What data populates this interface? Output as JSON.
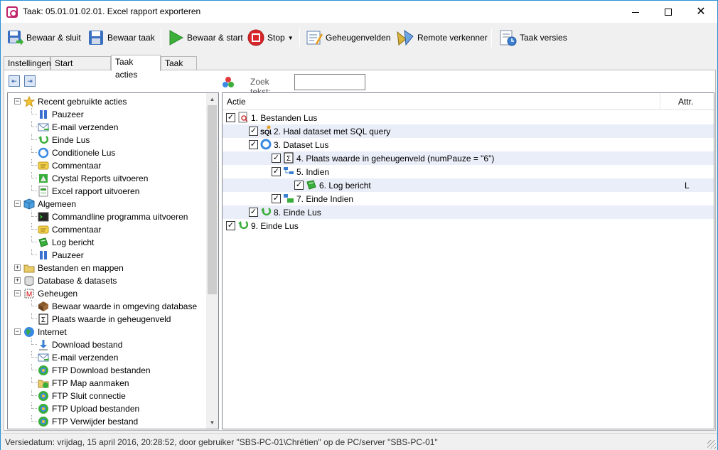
{
  "window": {
    "title": "Taak: 05.01.01.02.01. Excel rapport exporteren"
  },
  "toolbar": {
    "save_close": "Bewaar & sluit",
    "save_task": "Bewaar taak",
    "save_start": "Bewaar & start",
    "stop": "Stop",
    "memory_fields": "Geheugenvelden",
    "remote_explorer": "Remote verkenner",
    "task_versions": "Taak versies"
  },
  "tabs": [
    "Instellingen",
    "Start momenten",
    "Taak acties",
    "Taak log"
  ],
  "active_tab": "Taak acties",
  "search": {
    "label": "Zoek tekst:",
    "value": ""
  },
  "tree": [
    {
      "label": "Recent gebruikte acties",
      "level": 0,
      "icon": "star-icon",
      "expanded": true
    },
    {
      "label": "Pauzeer",
      "level": 1,
      "icon": "pause-icon"
    },
    {
      "label": "E-mail verzenden",
      "level": 1,
      "icon": "email-icon"
    },
    {
      "label": "Einde Lus",
      "level": 1,
      "icon": "loop-end-icon"
    },
    {
      "label": "Conditionele Lus",
      "level": 1,
      "icon": "conditional-loop-icon"
    },
    {
      "label": "Commentaar",
      "level": 1,
      "icon": "comment-icon"
    },
    {
      "label": "Crystal Reports uitvoeren",
      "level": 1,
      "icon": "crystal-reports-icon"
    },
    {
      "label": "Excel rapport uitvoeren",
      "level": 1,
      "icon": "excel-icon"
    },
    {
      "label": "Algemeen",
      "level": 0,
      "icon": "cube-icon",
      "expanded": true
    },
    {
      "label": "Commandline programma uitvoeren",
      "level": 1,
      "icon": "terminal-icon"
    },
    {
      "label": "Commentaar",
      "level": 1,
      "icon": "comment-icon"
    },
    {
      "label": "Log bericht",
      "level": 1,
      "icon": "log-icon"
    },
    {
      "label": "Pauzeer",
      "level": 1,
      "icon": "pause-icon"
    },
    {
      "label": "Bestanden en mappen",
      "level": 0,
      "icon": "folder-icon",
      "expanded": false
    },
    {
      "label": "Database & datasets",
      "level": 0,
      "icon": "database-icon",
      "expanded": false
    },
    {
      "label": "Geheugen",
      "level": 0,
      "icon": "memory-icon",
      "expanded": true
    },
    {
      "label": "Bewaar waarde in omgeving database",
      "level": 1,
      "icon": "save-db-icon"
    },
    {
      "label": "Plaats waarde in geheugenveld",
      "level": 1,
      "icon": "sigma-icon"
    },
    {
      "label": "Internet",
      "level": 0,
      "icon": "globe-icon",
      "expanded": true
    },
    {
      "label": "Download bestand",
      "level": 1,
      "icon": "download-icon"
    },
    {
      "label": "E-mail verzenden",
      "level": 1,
      "icon": "email-icon"
    },
    {
      "label": "FTP Download bestanden",
      "level": 1,
      "icon": "ftp-icon"
    },
    {
      "label": "FTP Map aanmaken",
      "level": 1,
      "icon": "ftp-folder-icon"
    },
    {
      "label": "FTP Sluit connectie",
      "level": 1,
      "icon": "ftp-icon"
    },
    {
      "label": "FTP Upload bestanden",
      "level": 1,
      "icon": "ftp-icon"
    },
    {
      "label": "FTP Verwijder bestand",
      "level": 1,
      "icon": "ftp-icon"
    }
  ],
  "grid": {
    "col_action": "Actie",
    "col_attr": "Attr.",
    "rows": [
      {
        "label": "1. Bestanden Lus",
        "indent": 0,
        "icon": "file-search-icon",
        "attr": "",
        "alt": false
      },
      {
        "label": "2. Haal dataset met SQL query",
        "indent": 1,
        "icon": "sql-icon",
        "attr": "",
        "alt": true
      },
      {
        "label": "3. Dataset Lus",
        "indent": 1,
        "icon": "dataset-loop-icon",
        "attr": "",
        "alt": false
      },
      {
        "label": "4. Plaats waarde in geheugenveld (numPauze = \"6\")",
        "indent": 2,
        "icon": "sigma-icon",
        "attr": "",
        "alt": true
      },
      {
        "label": "5. Indien",
        "indent": 2,
        "icon": "if-icon",
        "attr": "",
        "alt": false
      },
      {
        "label": "6. Log bericht",
        "indent": 3,
        "icon": "log-icon",
        "attr": "L",
        "alt": true
      },
      {
        "label": "7. Einde Indien",
        "indent": 2,
        "icon": "end-if-icon",
        "attr": "",
        "alt": false
      },
      {
        "label": "8. Einde Lus",
        "indent": 1,
        "icon": "loop-end-icon",
        "attr": "",
        "alt": true
      },
      {
        "label": "9. Einde Lus",
        "indent": 0,
        "icon": "loop-end-icon",
        "attr": "",
        "alt": false
      }
    ]
  },
  "status": "Versiedatum: vrijdag, 15 april 2016, 20:28:52, door gebruiker \"SBS-PC-01\\Chrétien\" op de PC/server \"SBS-PC-01\""
}
